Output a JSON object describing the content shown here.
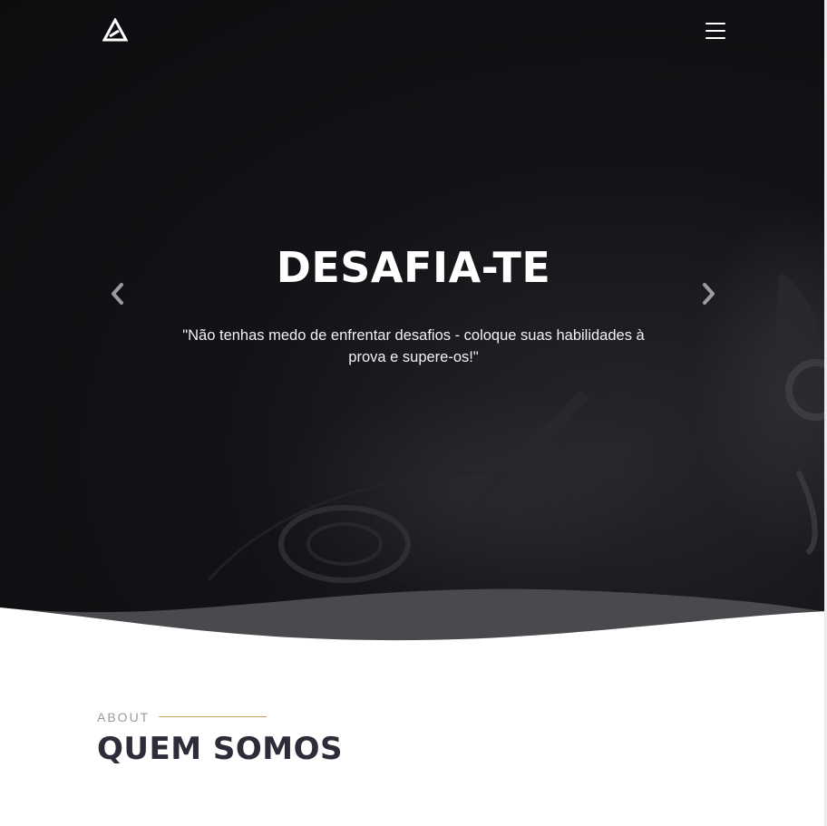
{
  "hero": {
    "title": "DESAFIA-TE",
    "quote": "\"Não tenhas medo de enfrentar desafios - coloque suas habilidades à prova e supere-os!\""
  },
  "nav": {
    "logo_icon": "triangle-logo-icon",
    "menu_icon": "hamburger-menu-icon"
  },
  "carousel": {
    "prev_icon": "chevron-left-icon",
    "next_icon": "chevron-right-icon"
  },
  "about": {
    "label": "ABOUT",
    "title": "QUEM SOMOS"
  },
  "colors": {
    "hero_bg": "#131317",
    "accent_line": "#c9a45c",
    "title_dark": "#2d2d3a",
    "label_gray": "#9a9a9a"
  }
}
